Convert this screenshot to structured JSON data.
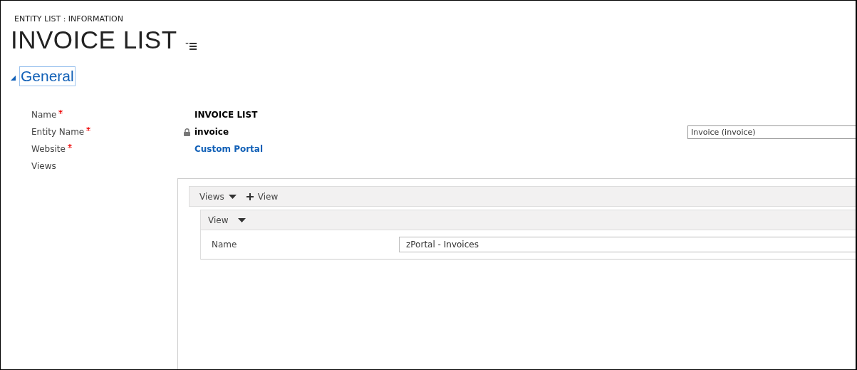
{
  "breadcrumb": "ENTITY LIST : INFORMATION",
  "title": "INVOICE LIST",
  "section": {
    "title": "General",
    "expanded": true
  },
  "fields": [
    {
      "label": "Name",
      "required": true,
      "locked": false,
      "kind": "text",
      "value": "INVOICE LIST"
    },
    {
      "label": "Entity Name",
      "required": true,
      "locked": true,
      "kind": "text",
      "value": "invoice",
      "dropdown": "Invoice (invoice)"
    },
    {
      "label": "Website",
      "required": true,
      "locked": false,
      "kind": "link",
      "value": "Custom Portal"
    },
    {
      "label": "Views",
      "required": false,
      "locked": false,
      "kind": "none"
    }
  ],
  "views": {
    "menu": "Views",
    "add": "View",
    "item": {
      "header": "View",
      "field_label": "Name",
      "field_value": "zPortal - Invoices"
    }
  }
}
